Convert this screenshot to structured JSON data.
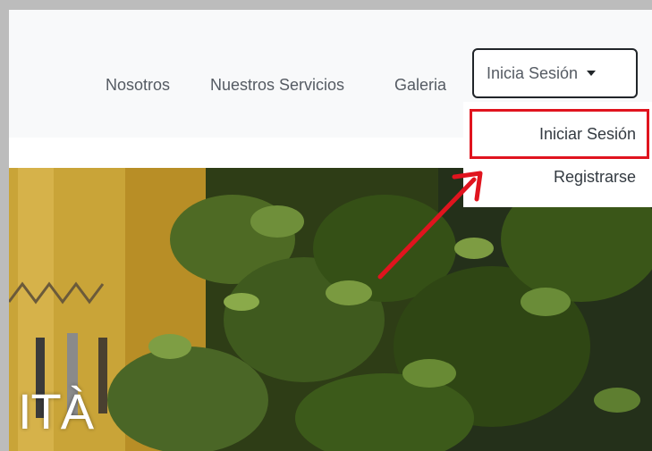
{
  "navbar": {
    "links": [
      {
        "label": "Nosotros"
      },
      {
        "label": "Nuestros Servicios"
      },
      {
        "label": "Galeria"
      }
    ],
    "dropdown_toggle_label": "Inicia Sesión"
  },
  "dropdown_menu": {
    "items": [
      {
        "label": "Iniciar Sesión"
      },
      {
        "label": "Registrarse"
      }
    ]
  },
  "hero": {
    "text": "ITÀ"
  },
  "annotation": {
    "color": "#e0141e"
  }
}
